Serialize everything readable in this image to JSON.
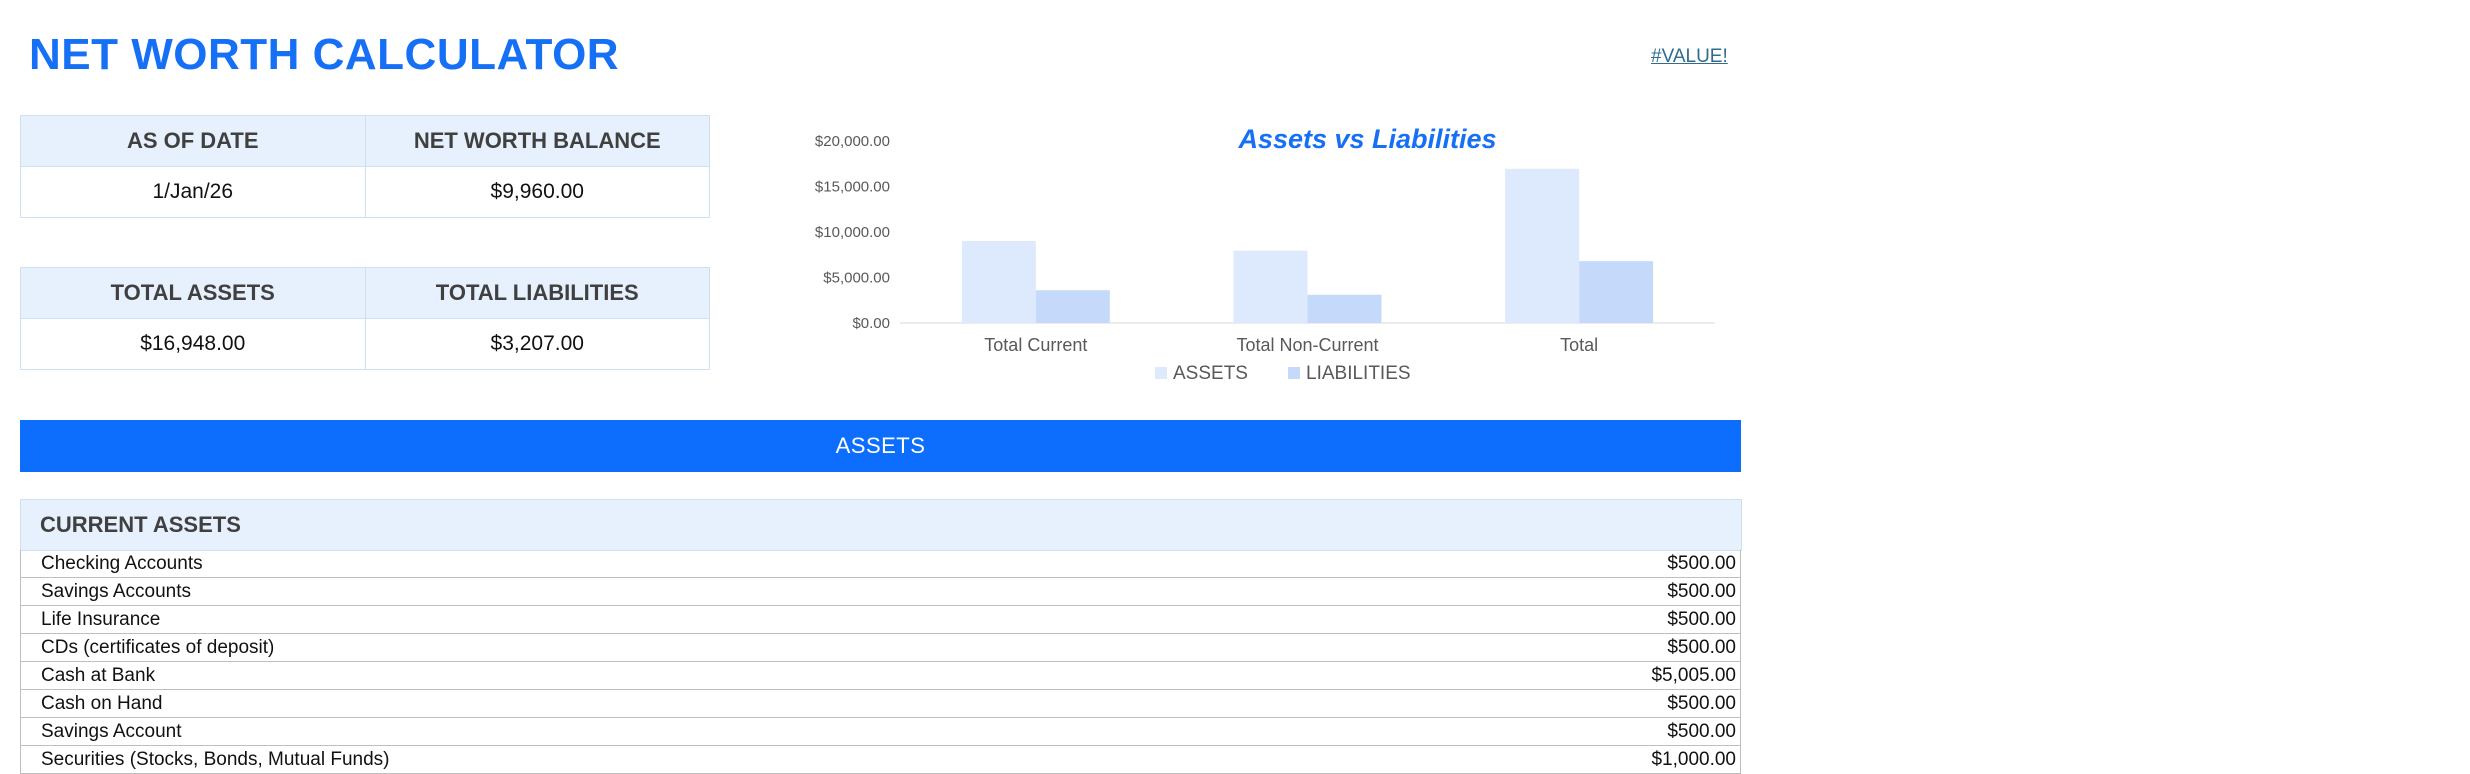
{
  "title": "NET WORTH CALCULATOR",
  "error_link": "#VALUE!",
  "summary_top": {
    "as_of_date_label": "AS OF DATE",
    "net_worth_label": "NET WORTH BALANCE",
    "as_of_date": "1/Jan/26",
    "net_worth": "$9,960.00"
  },
  "summary_bottom": {
    "total_assets_label": "TOTAL ASSETS",
    "total_liabilities_label": "TOTAL LIABILITIES",
    "total_assets": "$16,948.00",
    "total_liabilities": "$3,207.00"
  },
  "chart_data": {
    "type": "bar",
    "title": "Assets vs Liabilities",
    "categories": [
      "Total Current",
      "Total Non-Current",
      "Total"
    ],
    "series": [
      {
        "name": "ASSETS",
        "values": [
          9005,
          7943,
          16948
        ],
        "color": "#dde9fc"
      },
      {
        "name": "LIABILITIES",
        "values": [
          3600,
          3100,
          6800
        ],
        "color": "#c5dafb"
      }
    ],
    "ylim": [
      0,
      20000
    ],
    "yticks": [
      "$0.00",
      "$5,000.00",
      "$10,000.00",
      "$15,000.00",
      "$20,000.00"
    ],
    "ytick_values": [
      0,
      5000,
      10000,
      15000,
      20000
    ],
    "legend_position": "bottom",
    "grid": false
  },
  "assets_section": {
    "band_label": "ASSETS",
    "current_assets_label": "CURRENT ASSETS",
    "items": [
      {
        "name": "Checking Accounts",
        "value": "$500.00"
      },
      {
        "name": "Savings Accounts",
        "value": "$500.00"
      },
      {
        "name": "Life Insurance",
        "value": "$500.00"
      },
      {
        "name": "CDs (certificates of deposit)",
        "value": "$500.00"
      },
      {
        "name": "Cash at Bank",
        "value": "$5,005.00"
      },
      {
        "name": "Cash on Hand",
        "value": "$500.00"
      },
      {
        "name": "Savings Account",
        "value": "$500.00"
      },
      {
        "name": "Securities (Stocks, Bonds, Mutual Funds)",
        "value": "$1,000.00"
      }
    ]
  }
}
